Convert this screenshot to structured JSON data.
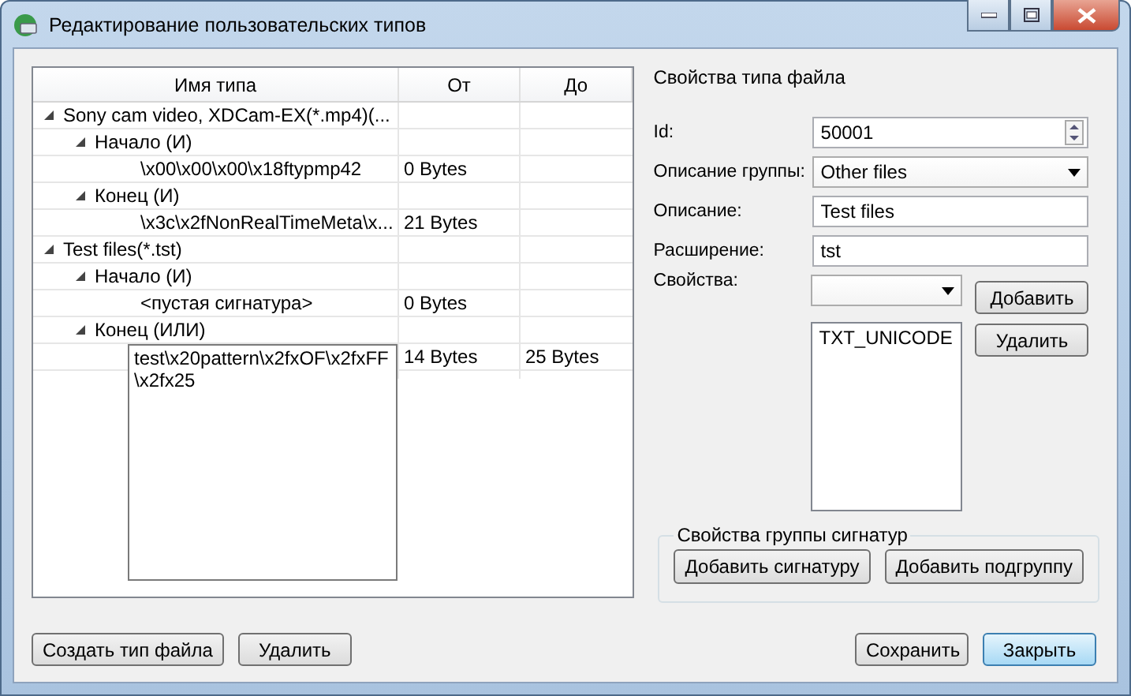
{
  "window": {
    "title": "Редактирование пользовательских типов"
  },
  "tree": {
    "columns": [
      "Имя типа",
      "От",
      "До"
    ],
    "rows": [
      {
        "name": "Sony cam video, XDCam-EX(*.mp4)(...",
        "expanded": true,
        "children": [
          {
            "name": "Начало (И)",
            "expanded": true,
            "children": [
              {
                "name": "\\x00\\x00\\x00\\x18ftypmp42",
                "from": "0 Bytes",
                "editing": false
              }
            ]
          },
          {
            "name": "Конец (И)",
            "expanded": true,
            "children": [
              {
                "name": "\\x3c\\x2fNonRealTimeMeta\\x...",
                "from": "21 Bytes",
                "editing": false
              }
            ]
          }
        ]
      },
      {
        "name": "Test files(*.tst)",
        "expanded": true,
        "children": [
          {
            "name": "Начало (И)",
            "expanded": true,
            "children": [
              {
                "name": "<пустая сигнатура>",
                "from": "0 Bytes",
                "editing": false
              }
            ]
          },
          {
            "name": "Конец (ИЛИ)",
            "expanded": true,
            "children": [
              {
                "name": "test\\x20pattern\\x2fxOF\\x2fxFF\\x2fx25",
                "from": "14 Bytes",
                "to": "25 Bytes",
                "editing": true
              }
            ]
          }
        ]
      }
    ]
  },
  "properties": {
    "title": "Свойства типа файла",
    "fields": [
      {
        "kind": "spin",
        "label": "Id:",
        "value": "50001"
      },
      {
        "kind": "combo",
        "label": "Описание группы:",
        "value": "Other files"
      },
      {
        "kind": "text",
        "label": "Описание:",
        "value": "Test files"
      },
      {
        "kind": "text",
        "label": "Расширение:",
        "value": "tst"
      }
    ],
    "attributes": {
      "label": "Свойства:",
      "add_button": "Добавить",
      "remove_button": "Удалить",
      "items": [
        {
          "label": "TXT_UNICODE",
          "selected": false
        }
      ]
    }
  },
  "signature_group": {
    "title": "Свойства группы сигнатур",
    "buttons": [
      "Добавить сигнатуру",
      "Добавить подгруппу"
    ]
  },
  "left_buttons": [
    "Создать тип файла",
    "Удалить"
  ],
  "dialog_buttons": [
    {
      "label": "Сохранить",
      "default": false
    },
    {
      "label": "Закрыть",
      "default": true
    }
  ]
}
